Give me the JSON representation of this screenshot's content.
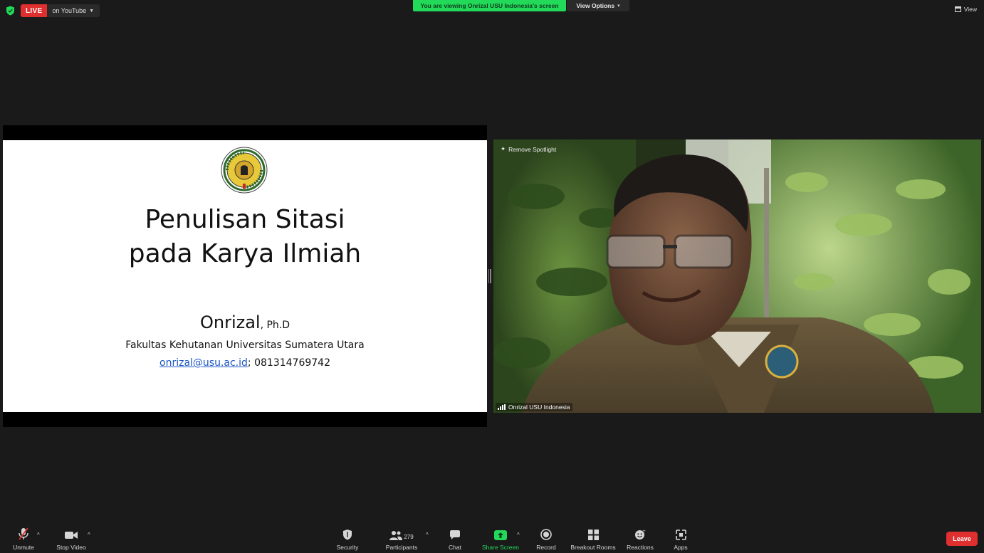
{
  "top_bar": {
    "live_label": "LIVE",
    "live_destination": "on YouTube",
    "viewing_banner": "You are viewing Onrizal USU Indonesia's screen",
    "view_options_label": "View Options",
    "view_label": "View"
  },
  "slide": {
    "title_line1": "Penulisan Sitasi",
    "title_line2": "pada Karya Ilmiah",
    "author_name": "Onrizal",
    "author_suffix": ", Ph.D",
    "affiliation": "Fakultas Kehutanan Universitas Sumatera Utara",
    "email": "onrizal@usu.ac.id",
    "phone": "; 081314769742"
  },
  "video": {
    "remove_spotlight": "Remove Spotlight",
    "participant_name": "Onrizal USU Indonesia"
  },
  "toolbar": {
    "unmute": "Unmute",
    "stop_video": "Stop Video",
    "security": "Security",
    "participants": "Participants",
    "participants_count": "279",
    "chat": "Chat",
    "share_screen": "Share Screen",
    "record": "Record",
    "breakout_rooms": "Breakout Rooms",
    "reactions": "Reactions",
    "apps": "Apps",
    "leave": "Leave"
  },
  "colors": {
    "live_red": "#e02f2f",
    "share_green": "#23d959",
    "background": "#1a1a1a"
  }
}
